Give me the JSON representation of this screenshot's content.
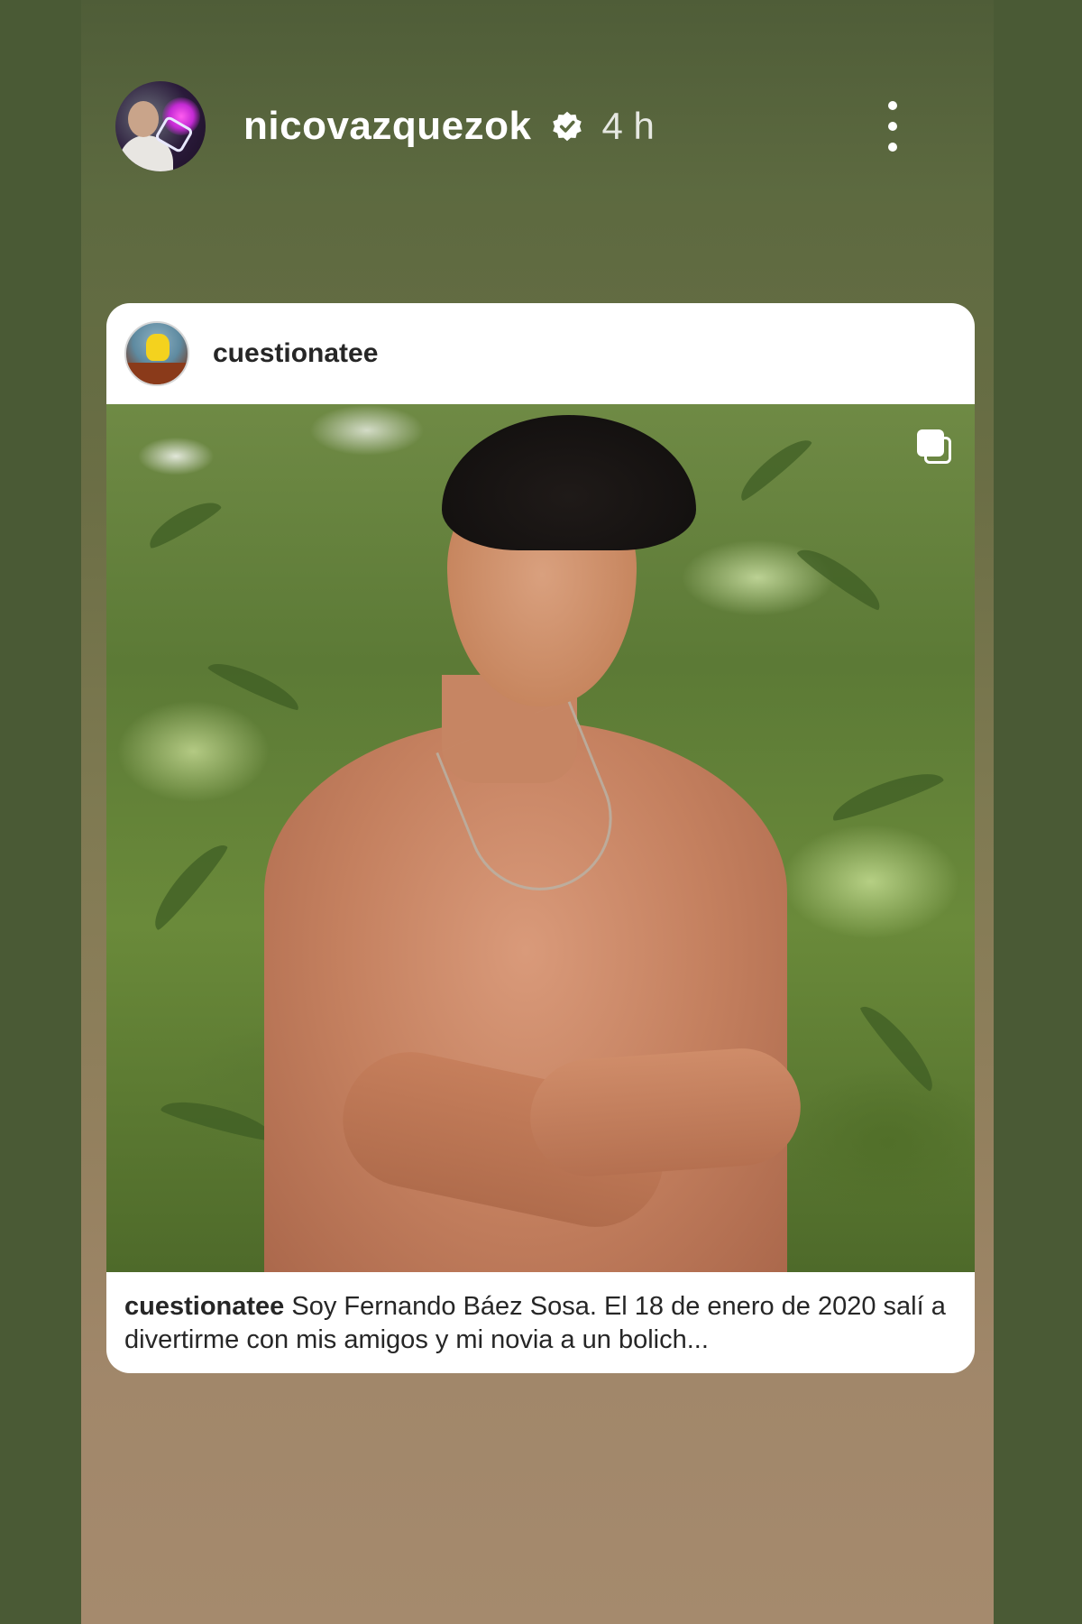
{
  "story": {
    "author": {
      "username": "nicovazquezok",
      "verified": true,
      "verified_icon": "verified-badge-icon",
      "time_ago": "4 h"
    },
    "menu_icon": "more-vertical-icon"
  },
  "shared_post": {
    "author": {
      "username": "cuestionatee"
    },
    "media": {
      "type": "carousel",
      "carousel_icon": "multiple-images-icon",
      "description": "shirtless young man smiling with arms crossed in front of bamboo foliage"
    },
    "caption": {
      "username": "cuestionatee",
      "text": "Soy Fernando Báez Sosa. El 18 de enero de 2020 salí a divertirme con mis amigos y mi novia a un bolich..."
    }
  },
  "colors": {
    "background": "#4a5a35",
    "card": "#ffffff",
    "text_dark": "#262626",
    "text_light": "#ffffff"
  }
}
